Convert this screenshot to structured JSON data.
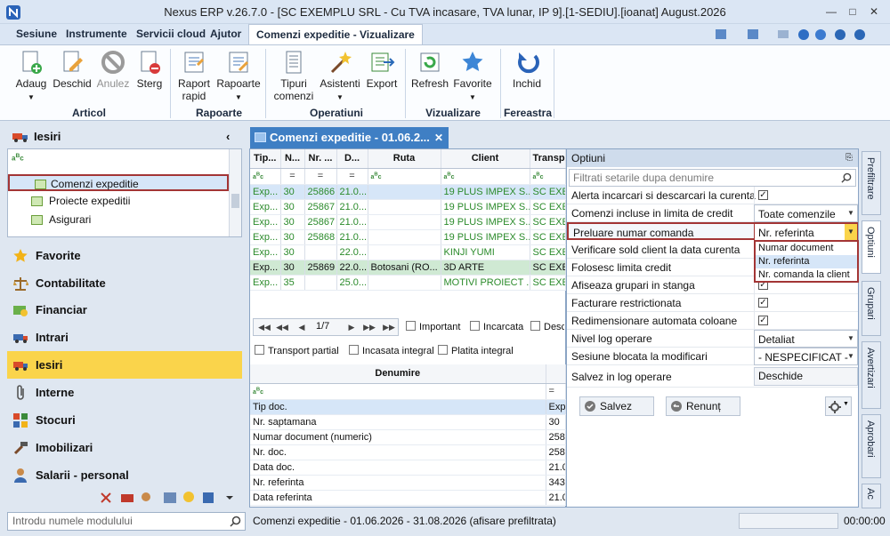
{
  "window": {
    "title": "Nexus ERP v.26.7.0 - [SC EXEMPLU SRL - Cu TVA incasare, TVA lunar, IP 9].[1-SEDIU].[ioanat] August.2026"
  },
  "menu_tabs": [
    "Sesiune",
    "Instrumente",
    "Servicii cloud",
    "Ajutor",
    "Comenzi expeditie - Vizualizare"
  ],
  "ribbon": {
    "buttons": [
      {
        "label": "Adaug",
        "icon": "add-document-icon",
        "disabled": false
      },
      {
        "label": "Deschid",
        "icon": "edit-document-icon",
        "disabled": false
      },
      {
        "label": "Anulez",
        "icon": "cancel-icon",
        "disabled": true
      },
      {
        "label": "Sterg",
        "icon": "delete-document-icon",
        "disabled": false
      },
      {
        "label": "Raport rapid",
        "icon": "quick-report-icon",
        "disabled": false
      },
      {
        "label": "Rapoarte",
        "icon": "reports-icon",
        "disabled": false
      },
      {
        "label": "Tipuri comenzi",
        "icon": "order-types-icon",
        "disabled": false
      },
      {
        "label": "Asistenti",
        "icon": "wizard-icon",
        "disabled": false
      },
      {
        "label": "Export",
        "icon": "export-icon",
        "disabled": false
      },
      {
        "label": "Refresh",
        "icon": "refresh-icon",
        "disabled": false
      },
      {
        "label": "Favorite",
        "icon": "star-icon",
        "disabled": false
      },
      {
        "label": "Inchid",
        "icon": "close-arrow-icon",
        "disabled": false
      }
    ],
    "groups": [
      "Articol",
      "Rapoarte",
      "Operatiuni",
      "Vizualizare",
      "Fereastra"
    ]
  },
  "left": {
    "header": "Iesiri",
    "tree": [
      "Comenzi expeditie",
      "Proiecte expeditii",
      "Asigurari"
    ],
    "modules": [
      {
        "label": "Favorite",
        "icon": "star-icon"
      },
      {
        "label": "Contabilitate",
        "icon": "scale-icon"
      },
      {
        "label": "Financiar",
        "icon": "money-icon"
      },
      {
        "label": "Intrari",
        "icon": "truck-in-icon"
      },
      {
        "label": "Iesiri",
        "icon": "truck-out-icon"
      },
      {
        "label": "Interne",
        "icon": "paperclip-icon"
      },
      {
        "label": "Stocuri",
        "icon": "blocks-icon"
      },
      {
        "label": "Imobilizari",
        "icon": "tools-icon"
      },
      {
        "label": "Salarii - personal",
        "icon": "person-icon"
      }
    ],
    "search_placeholder": "Introdu numele modulului"
  },
  "doc_tab": {
    "title": "Comenzi expeditie - 01.06.2..."
  },
  "grid": {
    "headers": [
      "Tip...",
      "N...",
      "Nr. ...",
      "D...",
      "Ruta",
      "Client",
      "Transp"
    ],
    "filter_row": [
      "=",
      "=",
      "=",
      "=",
      "",
      "",
      ""
    ],
    "rows": [
      [
        "Exp...",
        "30",
        "25866",
        "21.0...",
        "",
        "19 PLUS IMPEX S...",
        "SC EXE"
      ],
      [
        "Exp...",
        "30",
        "25867",
        "21.0...",
        "",
        "19 PLUS IMPEX S...",
        "SC EXE"
      ],
      [
        "Exp...",
        "30",
        "25867",
        "21.0...",
        "",
        "19 PLUS IMPEX S...",
        "SC EXE"
      ],
      [
        "Exp...",
        "30",
        "25868",
        "21.0...",
        "",
        "19 PLUS IMPEX S...",
        "SC EXE"
      ],
      [
        "Exp...",
        "30",
        "",
        "22.0...",
        "",
        "KINJI YUMI",
        "SC EXE"
      ],
      [
        "Exp...",
        "30",
        "25869",
        "22.0...",
        "Botosani (RO...",
        "3D ARTE",
        "SC EXE"
      ],
      [
        "Exp...",
        "35",
        "",
        "25.0...",
        "",
        "MOTIVI PROIECT ...",
        "SC EXE"
      ]
    ]
  },
  "pager": {
    "page": "1/7",
    "checks": [
      "Important",
      "Incarcata",
      "Desca"
    ]
  },
  "filters2": [
    "Transport partial",
    "Incasata integral",
    "Platita integral"
  ],
  "detail": {
    "header": "Denumire",
    "rows": [
      [
        "Tip doc.",
        "Exp"
      ],
      [
        "Nr. saptamana",
        "30"
      ],
      [
        "Numar document (numeric)",
        "258"
      ],
      [
        "Nr. doc.",
        "258"
      ],
      [
        "Data doc.",
        "21.0"
      ],
      [
        "Nr. referinta",
        "343"
      ],
      [
        "Data referinta",
        "21.0"
      ]
    ]
  },
  "options": {
    "title": "Optiuni",
    "filter_placeholder": "Filtrati setarile dupa denumire",
    "rows": [
      {
        "label": "Alerta incarcari si descarcari la curenta",
        "type": "check",
        "checked": true
      },
      {
        "label": "Comenzi incluse in limita de credit",
        "type": "dropdown",
        "value": "Toate comenzile"
      },
      {
        "label": "Preluare numar comanda",
        "type": "dropdown",
        "value": "Nr. referinta"
      },
      {
        "label": "Verificare sold client la data curenta",
        "type": "none"
      },
      {
        "label": "Folosesc limita credit",
        "type": "none"
      },
      {
        "label": "Afiseaza grupari in stanga",
        "type": "check",
        "checked": true
      },
      {
        "label": "Facturare restrictionata",
        "type": "check",
        "checked": true
      },
      {
        "label": "Redimensionare automata coloane",
        "type": "check",
        "checked": true
      },
      {
        "label": "Nivel log operare",
        "type": "dropdown",
        "value": "Detaliat"
      },
      {
        "label": "Sesiune blocata la modificari",
        "type": "dropdown",
        "value": "- NESPECIFICAT -"
      },
      {
        "label": "Salvez in log operare",
        "type": "button",
        "value": "Deschide"
      }
    ],
    "dropdown_options": [
      "Numar document",
      "Nr. referinta",
      "Nr. comanda la client"
    ],
    "save": "Salvez",
    "cancel": "Renunț"
  },
  "side_tabs": [
    "Prefiltrare",
    "Optiuni",
    "Grupari",
    "Avertizari",
    "Aprobari",
    "Ac"
  ],
  "status": {
    "text": "Comenzi expeditie - 01.06.2026 - 31.08.2026 (afisare prefiltrata)",
    "time": "00:00:00"
  }
}
